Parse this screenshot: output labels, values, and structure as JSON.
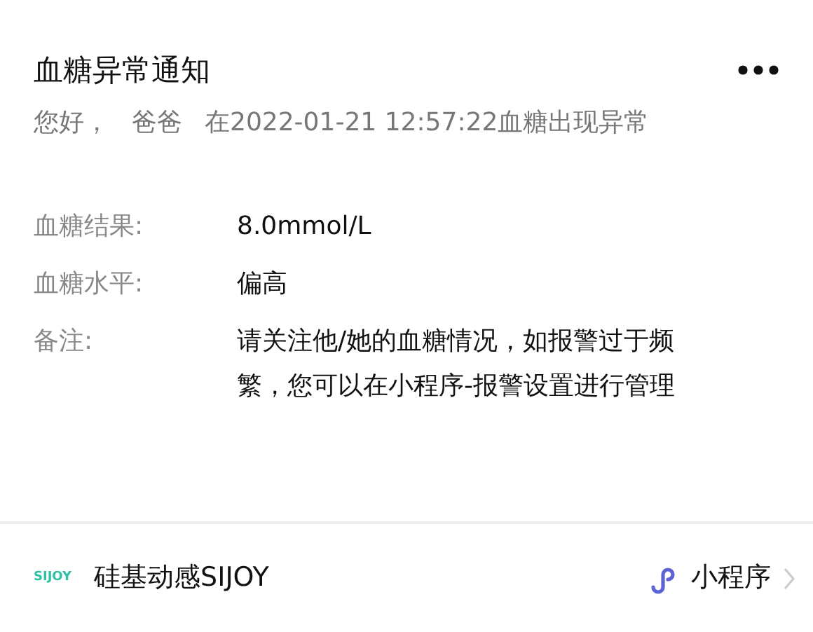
{
  "title": "血糖异常通知",
  "greeting": [
    "您好，",
    "爸爸",
    "在2022-01-21 12:57:22血糖出现异常"
  ],
  "fields": [
    {
      "label": "血糖结果:",
      "value": "8.0mmol/L"
    },
    {
      "label": "血糖水平:",
      "value": "偏高"
    },
    {
      "label": "备注:",
      "value": "请关注他/她的血糖情况，如报警过于频繁，您可以在小程序-报警设置进行管理"
    }
  ],
  "footer": {
    "logo": "SIJOY",
    "name": "硅基动感SIJOY",
    "link": "小程序"
  }
}
